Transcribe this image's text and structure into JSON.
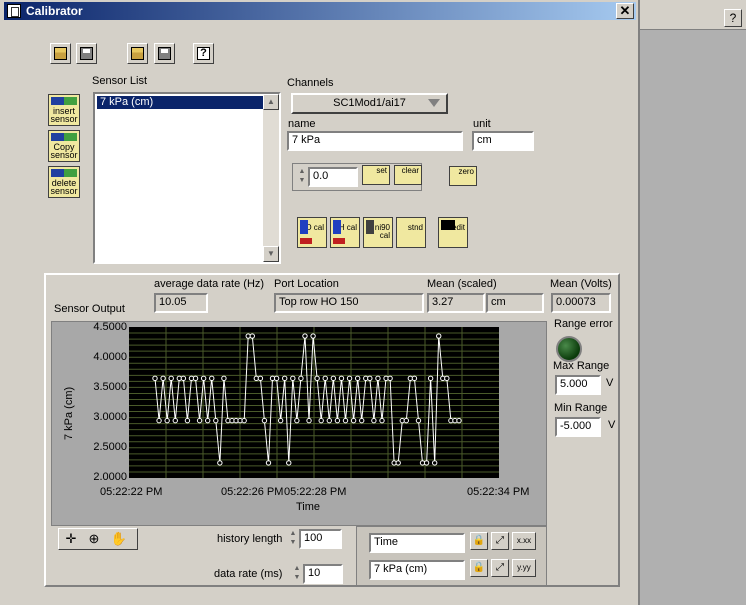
{
  "window": {
    "title": "Calibrator",
    "close_label": "✕"
  },
  "help_label": "?",
  "toolbar": {
    "help_label": "?"
  },
  "sensor_list": {
    "label": "Sensor List",
    "items": [
      "7 kPa (cm)"
    ]
  },
  "side_buttons": {
    "insert": "insert sensor",
    "copy": "Copy sensor",
    "delete": "delete sensor"
  },
  "channels": {
    "label": "Channels",
    "value": "SC1Mod1/ai17"
  },
  "name": {
    "label": "name",
    "value": "7 kPa"
  },
  "unit": {
    "label": "unit",
    "value": "cm"
  },
  "numeric": {
    "value": "0.0",
    "set_label": "set",
    "clear_label": "clear",
    "zero_label": "zero"
  },
  "cal_buttons": {
    "do": "DO cal",
    "ph": "pH cal",
    "ni90": "ni90 cal",
    "stnd": "stnd",
    "edit": "edit"
  },
  "sensor_output": {
    "label": "Sensor Output",
    "avg_rate_label": "average data rate (Hz)",
    "avg_rate": "10.05",
    "port_label": "Port Location",
    "port": "Top row HO 150",
    "mean_scaled_label": "Mean (scaled)",
    "mean_scaled": "3.27",
    "mean_unit": "cm",
    "mean_volts_label": "Mean (Volts)",
    "mean_volts": "0.00073",
    "range_error_label": "Range error",
    "max_range_label": "Max Range",
    "max_range": "5.000",
    "max_unit": "V",
    "min_range_label": "Min Range",
    "min_range": "-5.000",
    "min_unit": "V"
  },
  "chart_data": {
    "type": "line",
    "ylabel": "7 kPa (cm)",
    "xlabel": "Time",
    "ylim": [
      2.0,
      4.5
    ],
    "yticks": [
      "4.5000",
      "4.0000",
      "3.5000",
      "3.0000",
      "2.5000",
      "2.0000"
    ],
    "xticks": [
      "05:22:22 PM",
      "05:22:26 PM",
      "05:22:28 PM",
      "05:22:34 PM"
    ],
    "grid": true,
    "series": [
      {
        "values": [
          3.65,
          2.95,
          3.65,
          2.95,
          3.65,
          2.95,
          3.65,
          3.65,
          2.95,
          3.65,
          3.65,
          2.95,
          3.65,
          2.95,
          3.65,
          2.95,
          2.25,
          3.65,
          2.95,
          2.95,
          2.95,
          2.95,
          2.95,
          4.35,
          4.35,
          3.65,
          3.65,
          2.95,
          2.25,
          3.65,
          3.65,
          2.95,
          3.65,
          2.25,
          3.65,
          2.95,
          3.65,
          4.35,
          2.95,
          4.35,
          3.65,
          2.95,
          3.65,
          2.95,
          3.65,
          2.95,
          3.65,
          2.95,
          3.65,
          2.95,
          3.65,
          2.95,
          3.65,
          3.65,
          2.95,
          3.65,
          2.95,
          3.65,
          3.65,
          2.25,
          2.25,
          2.95,
          2.95,
          3.65,
          3.65,
          2.95,
          2.25,
          2.25,
          3.65,
          2.25,
          4.35,
          3.65,
          3.65,
          2.95,
          2.95,
          2.95
        ]
      }
    ]
  },
  "history": {
    "label": "history length",
    "value": "100"
  },
  "data_rate": {
    "label": "data rate (ms)",
    "value": "10"
  },
  "scale": {
    "x_name": "Time",
    "y_name": "7 kPa (cm)",
    "x_fmt": "x.xx",
    "y_fmt": "y.yy"
  }
}
